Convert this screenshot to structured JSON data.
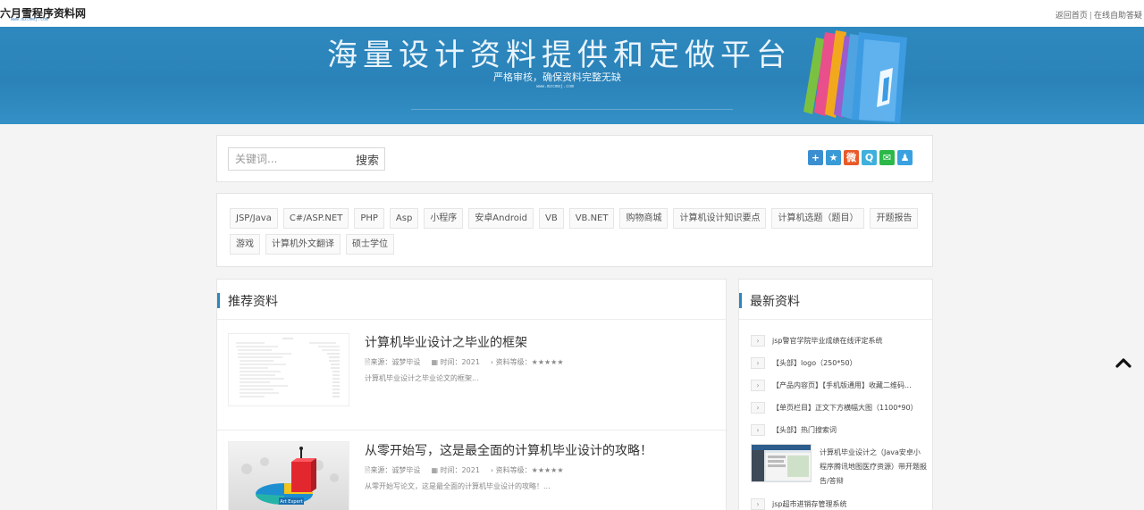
{
  "site": {
    "logo_text": "六月雪程序资料网",
    "logo_url_text": "www.mzcmej.com",
    "top_links": [
      "返回首页",
      "在线自助答疑"
    ],
    "top_link_separator": "|"
  },
  "banner": {
    "title": "海量设计资料提供和定做平台",
    "subtitle": "严格审核，确保资料完整无缺",
    "url_text": "www.mzcmej.com"
  },
  "search": {
    "placeholder": "关键词...",
    "button_label": "搜索"
  },
  "share_icons": [
    {
      "name": "plus-icon",
      "glyph": "+",
      "color": "#3b8fd1"
    },
    {
      "name": "star-icon",
      "glyph": "★",
      "color": "#3a9ad6"
    },
    {
      "name": "weibo-icon",
      "glyph": "微",
      "color": "#e85a2a"
    },
    {
      "name": "qzone-icon",
      "glyph": "Q",
      "color": "#3fb0dd"
    },
    {
      "name": "wechat-icon",
      "glyph": "✉",
      "color": "#2db84a"
    },
    {
      "name": "qq-icon",
      "glyph": "♟",
      "color": "#3aa1e0"
    }
  ],
  "tags": [
    "JSP/Java",
    "C#/ASP.NET",
    "PHP",
    "Asp",
    "小程序",
    "安卓Android",
    "VB",
    "VB.NET",
    "购物商城",
    "计算机设计知识要点",
    "计算机选题（题目）",
    "开题报告",
    "游戏",
    "计算机外文翻译",
    "硕士学位"
  ],
  "recommend": {
    "title": "推荐资料",
    "articles": [
      {
        "title": "计算机毕业设计之毕业的框架",
        "source": "来源：诚梦毕设",
        "time": "时间：2021",
        "level": "资料等级：★★★★★",
        "excerpt": "计算机毕业设计之毕业论文的框架..."
      },
      {
        "title": "从零开始写，这是最全面的计算机毕业设计的攻略！",
        "source": "来源：诚梦毕设",
        "time": "时间：2021",
        "level": "资料等级：★★★★★",
        "excerpt": "从零开始写论文，这是最全面的计算机毕业设计的攻略！...",
        "thumb_caption": "Art Expert"
      }
    ]
  },
  "latest": {
    "title": "最新资料",
    "items_top": [
      "jsp警官学院毕业成绩在线评定系统",
      "【头部】logo（250*50）",
      "【产品内容页】【手机版通用】收藏二维码...",
      "【单页栏目】正文下方横幅大图（1100*90）",
      "【头部】热门搜索词"
    ],
    "feature": "计算机毕业设计之（Java安卓小程序腾讯地图医疗资源）带开题报告/答辩",
    "items_bottom": [
      "jsp超市进销存管理系统"
    ]
  },
  "colors": {
    "banner_blue": "#2a82b8",
    "accent_blue": "#2b87bd"
  }
}
